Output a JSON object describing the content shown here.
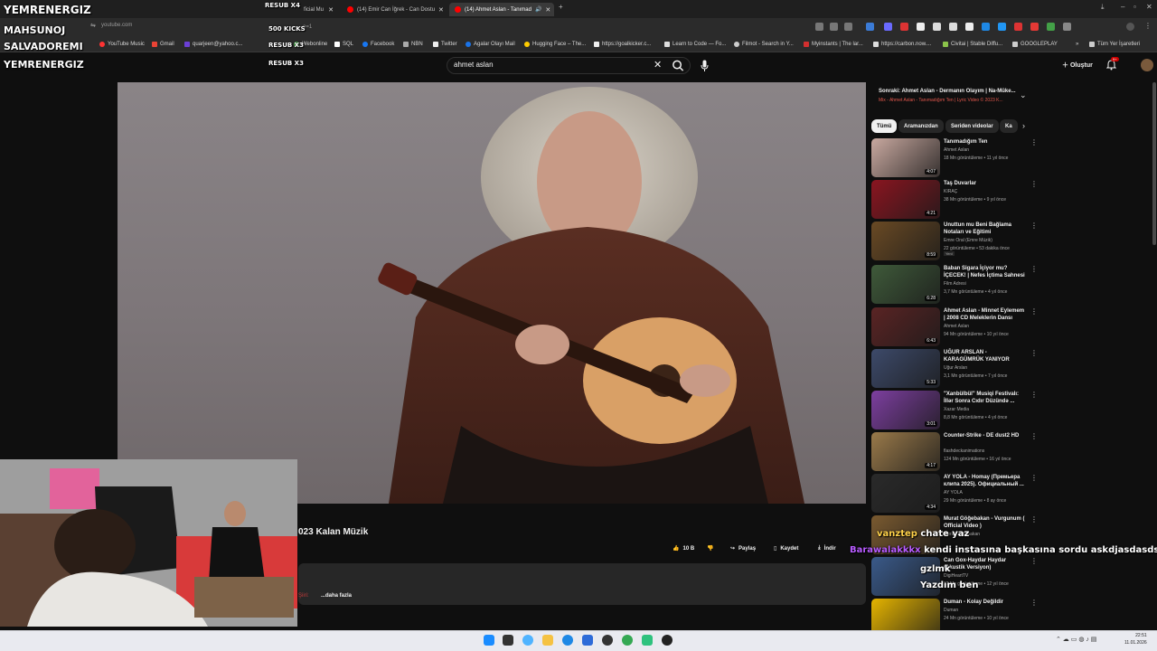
{
  "browser": {
    "tabs": [
      {
        "label": "ficial Mu"
      },
      {
        "label": "(14) Emir Can İğrek - Can Dostu"
      },
      {
        "label": "(14) Ahmet Aslan - Tanımad"
      }
    ],
    "url": "youtube.com",
    "url_suffix": "e=1",
    "bookmarks": [
      "YouTube Music",
      "Gmail",
      "quarjeen@yahoo.c...",
      "Webonline",
      "SQL",
      "Facebook",
      "NBN",
      "Twitter",
      "Agalar Olayı Mail",
      "Hugging Face – The...",
      "https://goalkicker.c...",
      "Learn to Code — Fo...",
      "Filmot - Search in Y...",
      "Myinstants | The lar...",
      "https://carbon.now....",
      "Civitai | Stable Diffu...",
      "GOOGLEPLAY"
    ],
    "bookmarks_all": "Tüm Yer İşaretleri"
  },
  "youtube": {
    "search_value": "ahmet aslan",
    "create_label": "Oluştur",
    "notif_count": "9+",
    "video_title": "023 Kalan Müzik",
    "actions": {
      "likes": "10 B",
      "share": "Paylaş",
      "save": "Kaydet",
      "download": "İndir"
    },
    "desc_more": "...daha fazla",
    "desc_prefix": "Şiiri:",
    "up_next_title": "Sonraki: Ahmet Aslan - Dermanın Olayım | Na-Müke...",
    "up_next_sub": "Mix - Ahmet Aslan - Tanımadığım Ten | Lyric Video © 2023 K...",
    "chips": [
      "Tümü",
      "Aramanızdan",
      "Seriden videolar",
      "Ka"
    ],
    "related": [
      {
        "title": "Tanımadığım Ten",
        "channel": "Ahmet Aslan",
        "meta": "18 Mn görüntüleme • 11 yıl önce",
        "duration": "4:07",
        "color": "#c9a9a0"
      },
      {
        "title": "Taş Duvarlar",
        "channel": "KIRAÇ",
        "meta": "38 Mn görüntüleme • 9 yıl önce",
        "duration": "4:21",
        "color": "#8a1520"
      },
      {
        "title": "Unuttun mu Beni Bağlama Notaları ve Eğitimi",
        "channel": "Emre Oral (Emre Müzik)",
        "meta": "22 görüntüleme • 53 dakika önce",
        "duration": "8:59",
        "color": "#6a4a24",
        "tag": "Yeni"
      },
      {
        "title": "Baban Sigara İçiyor mu? İÇECEK! | Nefes İçtima Sahnesi",
        "channel": "Film Adresi",
        "meta": "3,7 Mn görüntüleme • 4 yıl önce",
        "duration": "6:28",
        "color": "#3f5a3a"
      },
      {
        "title": "Ahmet Aslan - Minnet Eylemem | 2008 CD Meleklerin Dansı",
        "channel": "Ahmet Aslan",
        "meta": "94 Mn görüntüleme • 10 yıl önce",
        "duration": "6:43",
        "color": "#5a2424"
      },
      {
        "title": "UĞUR ARSLAN - KARAGÜMRÜK YANIYOR",
        "channel": "Uğur Arslan",
        "meta": "3,1 Mn görüntüleme • 7 yıl önce",
        "duration": "5:33",
        "color": "#3d4a6a"
      },
      {
        "title": "\"Xanbülbül\" Musiqi Festivalı: İllər Sonra Cıdır Düzündə ...",
        "channel": "Xazar Media",
        "meta": "8,8 Mn görüntüleme • 4 yıl önce",
        "duration": "3:01",
        "color": "#7d3fa0"
      },
      {
        "title": "Counter-Strike - DE dust2 HD",
        "channel": "flashdeckanimations",
        "meta": "124 Mn görüntüleme • 16 yıl önce",
        "duration": "4:17",
        "color": "#9a7a4a"
      },
      {
        "title": "AY YOLA - Homay (Премьера клипа 2025). Официальный ...",
        "channel": "AY YOLA",
        "meta": "29 Mn görüntüleme • 8 ay önce",
        "duration": "4:34",
        "color": "#2a2a2a"
      },
      {
        "title": "Murat Göğebakan - Vurgunum ( Official Video )",
        "channel": "Murat Göğebakan",
        "meta": "",
        "duration": "",
        "color": "#7a5a30"
      },
      {
        "title": "Can Gox-Haydar Haydar (Akustik Versiyon)",
        "channel": "DigiHeartTV",
        "meta": "12 Mn görüntüleme • 12 yıl önce",
        "duration": "",
        "color": "#3a5a8a"
      },
      {
        "title": "Duman - Kolay Değildir",
        "channel": "Duman",
        "meta": "24 Mn görüntüleme • 10 yıl önce",
        "duration": "",
        "color": "#e5b400"
      }
    ]
  },
  "overlays": {
    "alerts": [
      "YEMRENERGIZ",
      "MAHSUNOJ",
      "SALVADOREMI",
      "YEMRENERGIZ"
    ],
    "resubs": [
      "RESUB X4",
      "500 KICKS",
      "RESUB X3",
      "RESUB X3"
    ],
    "chat": [
      {
        "user": "vanztep",
        "text": "chate yaz"
      },
      {
        "user": "Barawalakkkx",
        "text": "kendi instasına başkasına sordu askdjasdasds"
      },
      {
        "user": "",
        "text": "gzlmk"
      },
      {
        "user": "",
        "text": "Yazdım ben"
      }
    ]
  },
  "taskbar": {
    "time": "22:51",
    "date": "11.01.2026"
  }
}
